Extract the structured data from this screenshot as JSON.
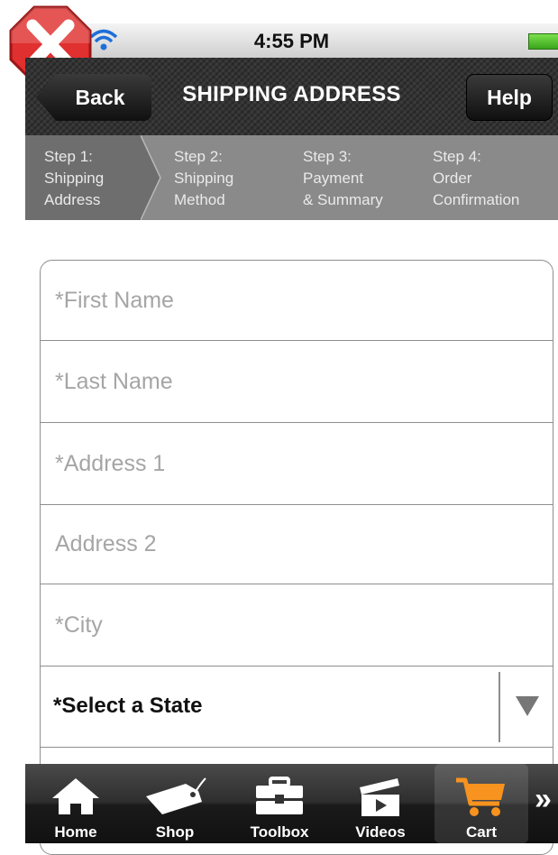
{
  "status_bar": {
    "time": "4:55 PM"
  },
  "nav": {
    "title": "SHIPPING ADDRESS",
    "back_label": "Back",
    "help_label": "Help"
  },
  "steps": [
    {
      "line1": "Step 1:",
      "line2": "Shipping",
      "line3": "Address"
    },
    {
      "line1": "Step 2:",
      "line2": "Shipping",
      "line3": "Method"
    },
    {
      "line1": "Step 3:",
      "line2": "Payment",
      "line3": "& Summary"
    },
    {
      "line1": "Step 4:",
      "line2": "Order",
      "line3": "Confirmation"
    }
  ],
  "form": {
    "first_name": {
      "placeholder": "*First Name",
      "value": ""
    },
    "last_name": {
      "placeholder": "*Last Name",
      "value": ""
    },
    "address1": {
      "placeholder": "*Address 1",
      "value": ""
    },
    "address2": {
      "placeholder": "Address 2",
      "value": ""
    },
    "city": {
      "placeholder": "*City",
      "value": ""
    },
    "state": {
      "label": "*Select a State"
    }
  },
  "tabs": [
    {
      "label": "Home",
      "icon": "home-icon"
    },
    {
      "label": "Shop",
      "icon": "tag-icon"
    },
    {
      "label": "Toolbox",
      "icon": "toolbox-icon"
    },
    {
      "label": "Videos",
      "icon": "video-clapper-icon"
    },
    {
      "label": "Cart",
      "icon": "cart-icon",
      "selected": true
    }
  ],
  "colors": {
    "accent": "#f7931e",
    "nav_bg": "#333333",
    "step_bg": "#8a8a8a"
  }
}
